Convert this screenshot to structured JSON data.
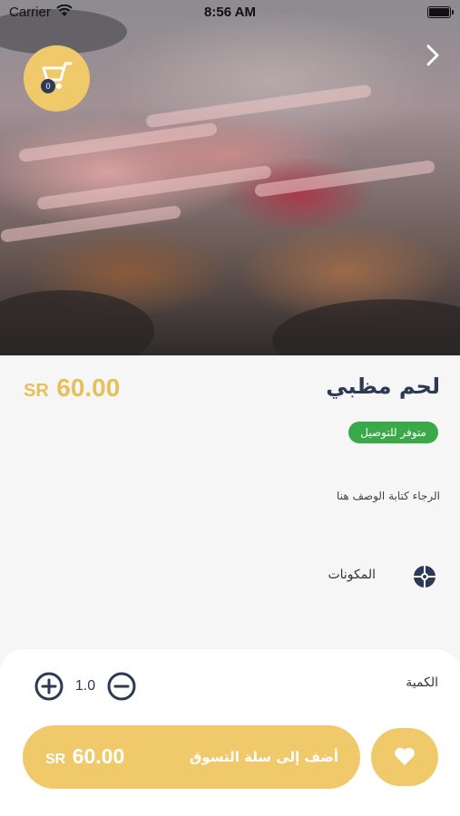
{
  "status_bar": {
    "carrier": "Carrier",
    "time": "8:56 AM"
  },
  "cart": {
    "count": "0"
  },
  "product": {
    "name": "لحم مظبي",
    "currency": "SR",
    "price": "60.00",
    "availability": "متوفر للتوصيل",
    "description": "الرجاء كتابة الوصف هنا",
    "ingredients_label": "المكونات"
  },
  "quantity": {
    "label": "الكمية",
    "value": "1.0"
  },
  "add_to_cart": {
    "label": "أضف إلى سلة التسوق",
    "currency": "SR",
    "price": "60.00"
  },
  "colors": {
    "accent": "#f0c96a",
    "price": "#e8c05a",
    "navy": "#2b3a55",
    "badge": "#3aa948"
  }
}
